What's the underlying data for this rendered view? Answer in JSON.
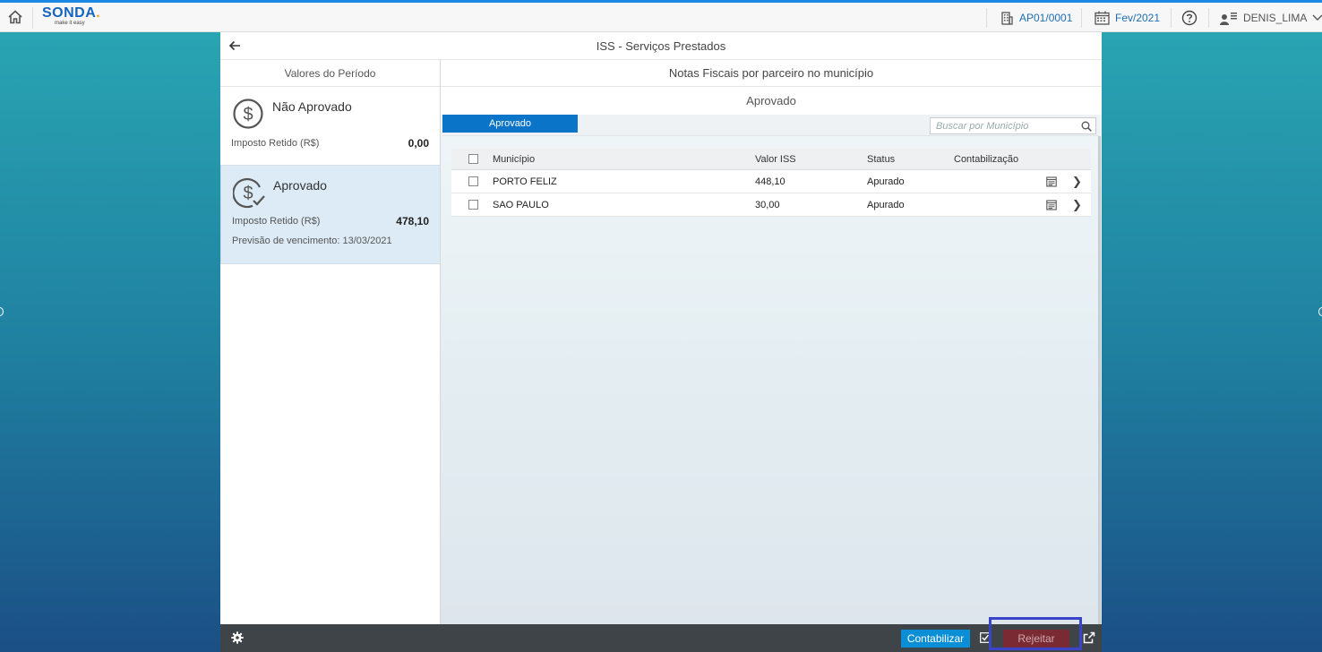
{
  "shellbar": {
    "logo_text": "SONDA",
    "logo_dot": ".",
    "logo_tagline": "make it easy",
    "company": "AP01/0001",
    "period": "Fev/2021",
    "user": "DENIS_LIMA"
  },
  "app": {
    "title": "ISS - Serviços Prestados"
  },
  "master": {
    "title": "Valores do Período",
    "items": [
      {
        "title": "Não Aprovado",
        "label": "Imposto Retido (R$)",
        "value": "0,00"
      },
      {
        "title": "Aprovado",
        "label": "Imposto Retido (R$)",
        "value": "478,10",
        "due": "Previsão de vencimento: 13/03/2021"
      }
    ]
  },
  "detail": {
    "title": "Notas Fiscais por parceiro no município",
    "section_title": "Aprovado",
    "tab_label": "Aprovado",
    "search_placeholder": "Buscar por Município",
    "columns": [
      "Município",
      "Valor ISS",
      "Status",
      "Contabilização"
    ],
    "rows": [
      {
        "municipio": "PORTO FELIZ",
        "valor": "448,10",
        "status": "Apurado"
      },
      {
        "municipio": "SAO PAULO",
        "valor": "30,00",
        "status": "Apurado"
      }
    ]
  },
  "footer": {
    "contabilizar_label": "Contabilizar",
    "rejeitar_label": "Rejeitar"
  },
  "colors": {
    "accent": "#0a74c9",
    "reject": "#7a2a32",
    "highlight": "#3a44c8"
  }
}
